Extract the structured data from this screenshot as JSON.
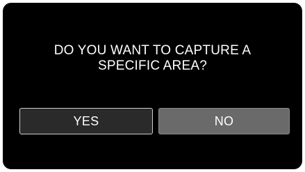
{
  "dialog": {
    "prompt_line1": "DO YOU WANT TO CAPTURE A",
    "prompt_line2": "SPECIFIC AREA?",
    "yes_label": "YES",
    "no_label": "NO"
  },
  "colors": {
    "background": "#000000",
    "text": "#ffffff",
    "yes_button": "#2a2a2a",
    "yes_border": "#d0d0d0",
    "no_button": "#6a6a6a"
  }
}
